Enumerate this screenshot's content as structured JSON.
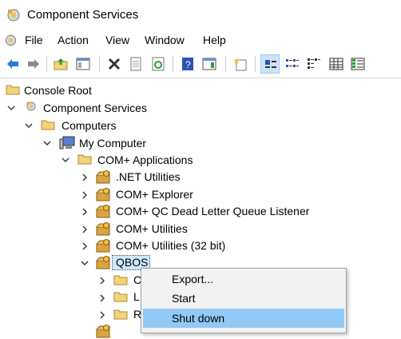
{
  "window": {
    "title": "Component Services"
  },
  "menu": [
    "File",
    "Action",
    "View",
    "Window",
    "Help"
  ],
  "toolbar": [
    "back",
    "forward",
    "up-folder",
    "show-hide-tree",
    "delete",
    "properties",
    "refresh",
    "help",
    "show-action-pane",
    "new",
    "large-icons",
    "small-icons",
    "list",
    "details",
    "status-view"
  ],
  "tree": {
    "root": "Console Root",
    "component_services": "Component Services",
    "computers": "Computers",
    "my_computer": "My Computer",
    "com_apps": "COM+ Applications",
    "apps": [
      ".NET Utilities",
      "COM+ Explorer",
      "COM+ QC Dead Letter Queue Listener",
      "COM+ Utilities",
      "COM+ Utilities (32 bit)"
    ],
    "qbos": "QBOS",
    "qbos_children": [
      "C",
      "L",
      "R"
    ]
  },
  "context_menu": {
    "items": [
      {
        "label": "Export...",
        "highlighted": false
      },
      {
        "label": "Start",
        "highlighted": false
      },
      {
        "label": "Shut down",
        "highlighted": true
      }
    ]
  },
  "colors": {
    "highlight": "#91c9f7",
    "folder": "#f3d27a",
    "selection": "#cce8ff"
  }
}
